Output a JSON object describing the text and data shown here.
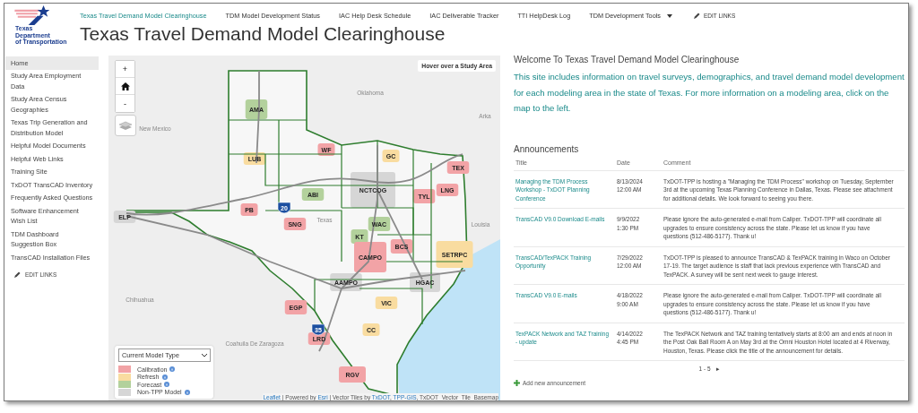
{
  "logo": {
    "lines": [
      "Texas",
      "Department",
      "of Transportation"
    ]
  },
  "nav": {
    "items": [
      {
        "label": "Texas Travel Demand Model Clearinghouse",
        "selected": true,
        "dropdown": false
      },
      {
        "label": "TDM Model Development Status",
        "selected": false,
        "dropdown": false
      },
      {
        "label": "IAC Help Desk Schedule",
        "selected": false,
        "dropdown": false
      },
      {
        "label": "IAC Deliverable Tracker",
        "selected": false,
        "dropdown": false
      },
      {
        "label": "TTI HelpDesk Log",
        "selected": false,
        "dropdown": false
      },
      {
        "label": "TDM Development Tools",
        "selected": false,
        "dropdown": true
      }
    ],
    "edit_links": "EDIT LINKS"
  },
  "page_title": "Texas Travel Demand Model Clearinghouse",
  "sidebar": {
    "items": [
      {
        "label": "Home",
        "selected": true
      },
      {
        "label": "Study Area Employment Data",
        "selected": false
      },
      {
        "label": "Study Area Census Geographies",
        "selected": false
      },
      {
        "label": "Texas Trip Generation and Distribution Model",
        "selected": false
      },
      {
        "label": "Helpful Model Documents",
        "selected": false
      },
      {
        "label": "Helpful Web Links",
        "selected": false
      },
      {
        "label": "Training Site",
        "selected": false
      },
      {
        "label": "TxDOT TransCAD Inventory",
        "selected": false
      },
      {
        "label": "Frequently Asked Questions",
        "selected": false
      },
      {
        "label": "Software Enhancement Wish List",
        "selected": false
      },
      {
        "label": "TDM Dashboard Suggestion Box",
        "selected": false
      },
      {
        "label": "TransCAD Installation Files",
        "selected": false
      }
    ],
    "edit_links": "EDIT LINKS"
  },
  "map": {
    "zoom_in": "+",
    "zoom_out": "-",
    "hover_info": "Hover over a Study Area",
    "place_labels": [
      "Oklahoma",
      "New Mexico",
      "Texas",
      "Arka",
      "Louisia",
      "Chihuahua",
      "Coahuila De Zaragoza"
    ],
    "shields": [
      "20",
      "35"
    ],
    "study_areas": [
      {
        "label": "AMA",
        "kind": "forecast"
      },
      {
        "label": "LUB",
        "kind": "refresh"
      },
      {
        "label": "WF",
        "kind": "calibration"
      },
      {
        "label": "GC",
        "kind": "refresh"
      },
      {
        "label": "TEX",
        "kind": "calibration"
      },
      {
        "label": "NCTCOG",
        "kind": "non_tpp"
      },
      {
        "label": "TYL",
        "kind": "calibration"
      },
      {
        "label": "LNG",
        "kind": "calibration"
      },
      {
        "label": "ABI",
        "kind": "forecast"
      },
      {
        "label": "ELP",
        "kind": "non_tpp"
      },
      {
        "label": "PB",
        "kind": "calibration"
      },
      {
        "label": "SNG",
        "kind": "calibration"
      },
      {
        "label": "WAC",
        "kind": "forecast"
      },
      {
        "label": "KT",
        "kind": "forecast"
      },
      {
        "label": "BCS",
        "kind": "calibration"
      },
      {
        "label": "CAMPO",
        "kind": "calibration"
      },
      {
        "label": "SETRPC",
        "kind": "refresh"
      },
      {
        "label": "AAMPO",
        "kind": "non_tpp"
      },
      {
        "label": "HGAC",
        "kind": "non_tpp"
      },
      {
        "label": "VIC",
        "kind": "refresh"
      },
      {
        "label": "EGP",
        "kind": "calibration"
      },
      {
        "label": "CC",
        "kind": "refresh"
      },
      {
        "label": "LRD",
        "kind": "calibration"
      },
      {
        "label": "RGV",
        "kind": "calibration"
      }
    ],
    "legend": {
      "select": "Current Model Type",
      "items": [
        {
          "label": "Calibration",
          "kind": "calibration",
          "color": "#f2a3a6"
        },
        {
          "label": "Refresh",
          "kind": "refresh",
          "color": "#f9dca0"
        },
        {
          "label": "Forecast",
          "kind": "forecast",
          "color": "#b3d19c"
        },
        {
          "label": "Non-TPP Model",
          "kind": "non_tpp",
          "color": "#d6d6d6"
        }
      ]
    },
    "attribution": {
      "parts": [
        {
          "text": "Leaflet",
          "link": true
        },
        {
          "text": " | Powered by ",
          "link": false
        },
        {
          "text": "Esri",
          "link": true
        },
        {
          "text": " | Vector Tiles by ",
          "link": false
        },
        {
          "text": "TxDOT",
          "link": true
        },
        {
          "text": ", ",
          "link": false
        },
        {
          "text": "TPP-GIS",
          "link": true
        },
        {
          "text": ", TxDOT_Vector_Tile_Basemap",
          "link": false
        }
      ]
    }
  },
  "welcome": {
    "title": "Welcome To Texas Travel Demand Model Clearinghouse",
    "text": "This site includes information on travel surveys, demographics, and travel demand model development for each modeling area in the state of Texas. For more information on a modeling area, click on the map to the left."
  },
  "announcements": {
    "title": "Announcements",
    "columns": [
      "Title",
      "Date",
      "Comment"
    ],
    "rows": [
      {
        "title": "Managing the TDM Process Workshop - TxDOT Planning Conference",
        "date": "8/13/2024",
        "time": "12:00 AM",
        "comment": "TxDOT-TPP is hosting a \"Managing the TDM Process\" workshop on Tuesday, September 3rd at the upcoming Texas Planning Conference in Dallas, Texas. Please see attachment for additional details. We look forward to seeing you there."
      },
      {
        "title": "TransCAD V9.0 Download E-mails",
        "date": "9/9/2022",
        "time": "1:30 PM",
        "comment": "Please ignore the auto-generated e-mail from Caliper.  TxDOT-TPP will coordinate all upgrades to ensure consistency across the state.  Please let us know if you have questions (512-486-5177).  Thank u!"
      },
      {
        "title": "TransCAD/TexPACK Training Opportunity",
        "date": "7/29/2022",
        "time": "12:00 AM",
        "comment": "TxDOT-TPP is pleased to announce TransCAD & TexPACK training in Waco on October 17-19.  The target audience is staff that lack previous experience with TransCAD and TexPACK.  A survey will be sent next week to gauge interest."
      },
      {
        "title": "TransCAD V9.0 E-mails",
        "date": "4/18/2022",
        "time": "9:00 AM",
        "comment": "Please ignore the auto-generated e-mail from Caliper.  TxDOT-TPP will coordinate all upgrades to ensure consistency across the state.  Please let us know if you have questions (512-486-5177).  Thank u!"
      },
      {
        "title": "TexPACK Network and TAZ Training - update",
        "date": "4/14/2022",
        "time": "4:45 PM",
        "comment": "The TexPACK Network and TAZ training tentatively starts at 8:00 am and ends at noon in the Post Oak Ball Room A on May 3rd at the Omni Houston Hotel located at 4 Riverway, Houston, Texas. Please click the title of the announcement for details."
      }
    ],
    "pager": "1 - 5",
    "next": "▸",
    "add": "Add new announcement"
  }
}
